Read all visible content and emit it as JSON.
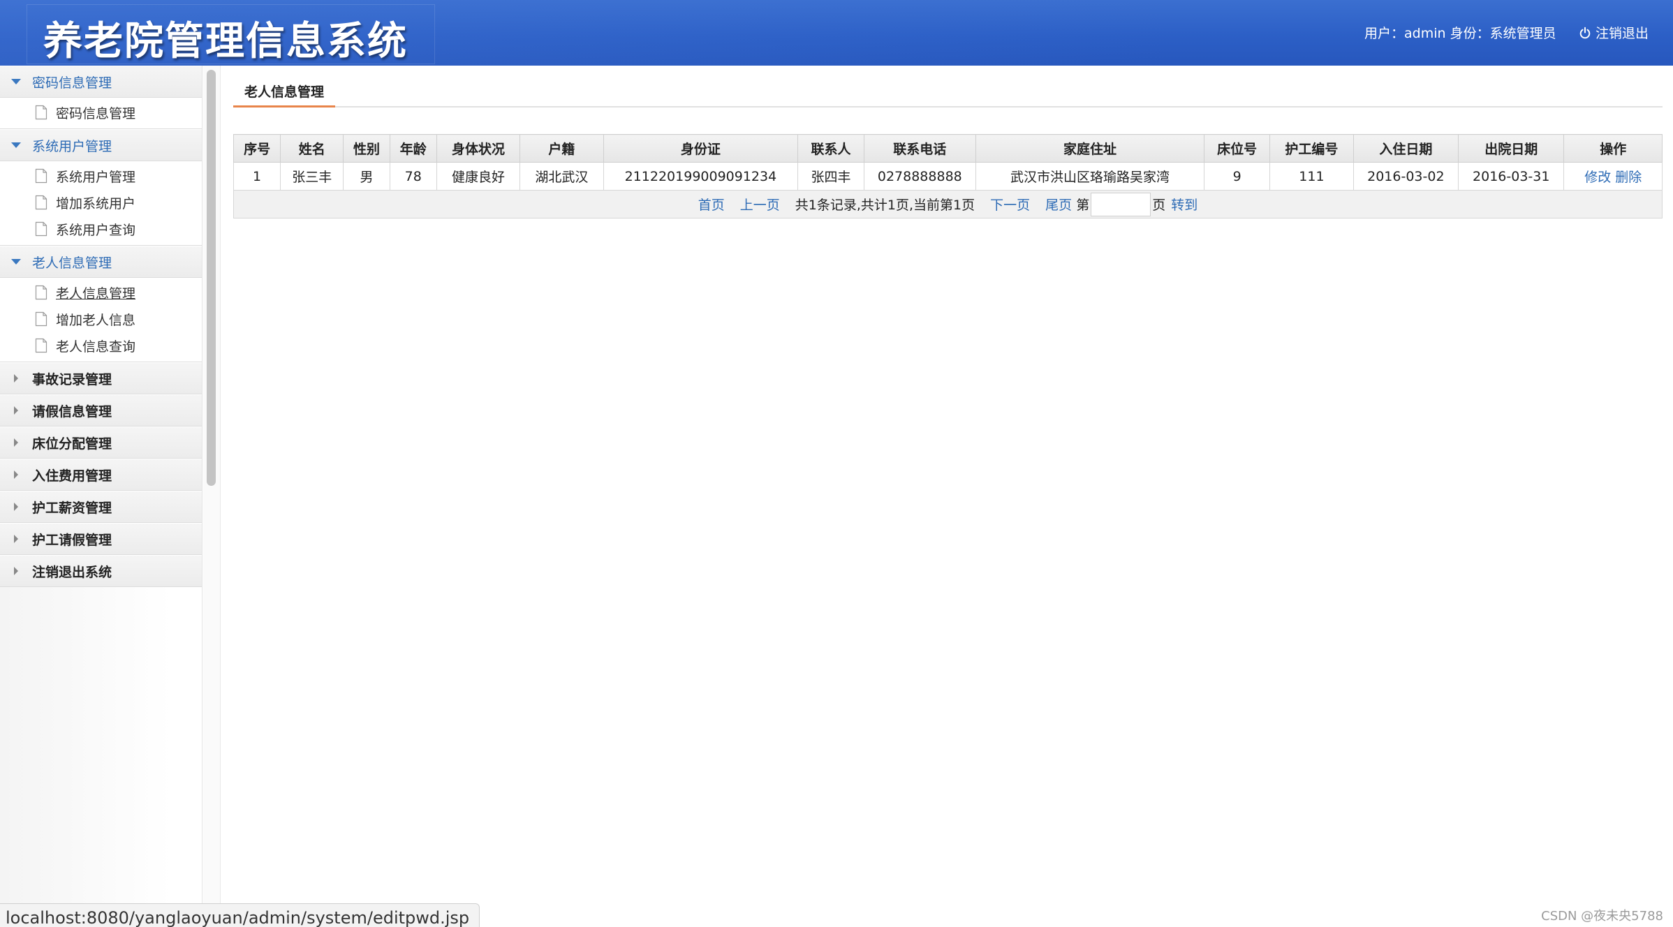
{
  "header": {
    "app_title": "养老院管理信息系统",
    "user_info": "用户：admin 身份：系统管理员",
    "logout_label": "注销退出"
  },
  "sidebar": {
    "groups": [
      {
        "label": "密码信息管理",
        "expanded": true,
        "items": [
          {
            "label": "密码信息管理"
          }
        ]
      },
      {
        "label": "系统用户管理",
        "expanded": true,
        "items": [
          {
            "label": "系统用户管理"
          },
          {
            "label": "增加系统用户"
          },
          {
            "label": "系统用户查询"
          }
        ]
      },
      {
        "label": "老人信息管理",
        "expanded": true,
        "items": [
          {
            "label": "老人信息管理"
          },
          {
            "label": "增加老人信息"
          },
          {
            "label": "老人信息查询"
          }
        ]
      },
      {
        "label": "事故记录管理",
        "expanded": false
      },
      {
        "label": "请假信息管理",
        "expanded": false
      },
      {
        "label": "床位分配管理",
        "expanded": false
      },
      {
        "label": "入住费用管理",
        "expanded": false
      },
      {
        "label": "护工薪资管理",
        "expanded": false
      },
      {
        "label": "护工请假管理",
        "expanded": false
      },
      {
        "label": "注销退出系统",
        "expanded": false
      }
    ]
  },
  "main": {
    "tab_label": "老人信息管理",
    "table": {
      "headers": [
        "序号",
        "姓名",
        "性别",
        "年龄",
        "身体状况",
        "户籍",
        "身份证",
        "联系人",
        "联系电话",
        "家庭住址",
        "床位号",
        "护工编号",
        "入住日期",
        "出院日期",
        "操作"
      ],
      "rows": [
        {
          "cells": [
            "1",
            "张三丰",
            "男",
            "78",
            "健康良好",
            "湖北武汉",
            "211220199009091234",
            "张四丰",
            "0278888888",
            "武汉市洪山区珞瑜路吴家湾",
            "9",
            "111",
            "2016-03-02",
            "2016-03-31"
          ],
          "edit_label": "修改",
          "delete_label": "删除"
        }
      ]
    },
    "pager": {
      "first": "首页",
      "prev": "上一页",
      "info": "共1条记录,共计1页,当前第1页",
      "next": "下一页",
      "last": "尾页",
      "page_prefix": "第",
      "page_value": "",
      "page_suffix": "页",
      "goto": "转到"
    }
  },
  "status_bar": {
    "url": "localhost:8080/yanglaoyuan/admin/system/editpwd.jsp"
  },
  "watermark": "CSDN @夜未央5788",
  "colors": {
    "header_blue": "#2c5fc6",
    "link_blue": "#2d6bb5",
    "tab_underline": "#e8844a"
  }
}
